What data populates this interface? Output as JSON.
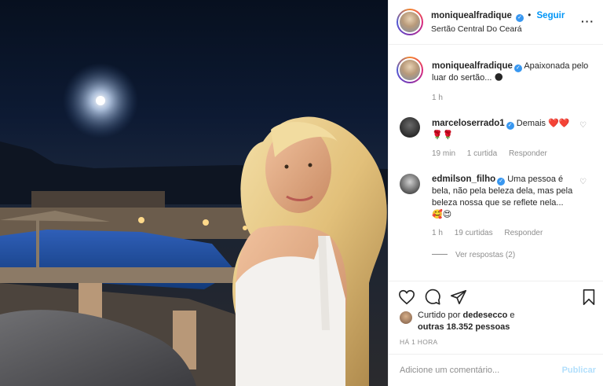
{
  "post": {
    "header": {
      "username": "moniquealfradique",
      "separator": "•",
      "follow_label": "Seguir",
      "location": "Sertão Central Do Ceará",
      "more_icon": "more-horizontal-icon"
    },
    "caption": {
      "username": "moniquealfradique",
      "text": "Apaixonada pelo luar do sertão... 🌑",
      "time": "1 h"
    },
    "comments": [
      {
        "username": "marceloserrado1",
        "text": "Demais ❤️❤️🌹🌹",
        "time": "19 min",
        "likes": "1 curtida",
        "reply_label": "Responder"
      },
      {
        "username": "edmilson_filho",
        "text": "Uma pessoa é bela, não pela beleza dela, mas pela beleza nossa que se reflete nela...🥰😍",
        "time": "1 h",
        "likes": "19 curtidas",
        "reply_label": "Responder",
        "view_replies": "Ver respostas (2)"
      }
    ],
    "actions": {
      "icons": [
        "heart-icon",
        "comment-icon",
        "share-icon",
        "bookmark-icon"
      ]
    },
    "likes": {
      "prefix": "Curtido por",
      "user": "dedesecco",
      "middle": "e",
      "others": "outras 18.352 pessoas"
    },
    "timestamp": "HÁ 1 HORA",
    "comment_input": {
      "placeholder": "Adicione um comentário...",
      "publish_label": "Publicar"
    },
    "colors": {
      "accent": "#0095f6",
      "verified": "#3897f0",
      "muted": "#8e8e8e",
      "text": "#262626",
      "heart_red": "#ed4956"
    }
  }
}
